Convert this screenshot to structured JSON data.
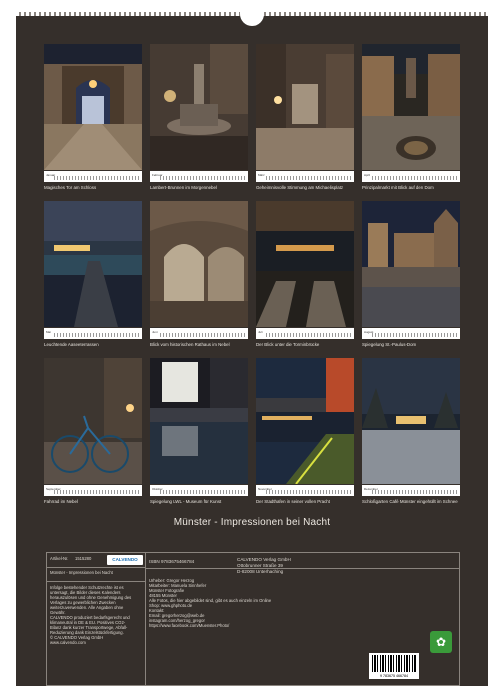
{
  "title": "Münster - Impressionen bei Nacht",
  "months": [
    {
      "month": "Januar",
      "caption": "Magisches Tor am Schloss"
    },
    {
      "month": "Februar",
      "caption": "Lambert-Brunnen im Morgennebel"
    },
    {
      "month": "März",
      "caption": "Geheimnisvolle Stimmung am Michaelisplatz"
    },
    {
      "month": "April",
      "caption": "Prinzipalmarkt mit Blick auf den Dom"
    },
    {
      "month": "Mai",
      "caption": "Leuchtende Aaseeterrassen"
    },
    {
      "month": "Juni",
      "caption": "Blick vom historischen Rathaus im Nebel"
    },
    {
      "month": "Juli",
      "caption": "Der Blick unter die Torminbrücke"
    },
    {
      "month": "August",
      "caption": "Spiegelung St.-Paulus-Dom"
    },
    {
      "month": "September",
      "caption": "Fahrrad im Nebel"
    },
    {
      "month": "Oktober",
      "caption": "Spiegelung LWL - Museum für Kunst"
    },
    {
      "month": "November",
      "caption": "Der Stadthafen in seiner vollen Pracht"
    },
    {
      "month": "Dezember",
      "caption": "Schloßgarten Café Münster eingehüllt im Schnee"
    }
  ],
  "info": {
    "artikel_label": "Artikel-Nr.",
    "artikel_value": "1515280",
    "logo": "CALVENDO",
    "product_name": "Münster - Impressionen bei Nacht",
    "legal": [
      "Infolge bestehender Schutzrechte ist es",
      "untersagt, die Bilder dieses Kalenders",
      "herauszulösen und ohne Genehmigung des",
      "Verlages zu gewerblichen Zwecken",
      "weiterzuverwenden. Alle Angaben ohne",
      "Gewähr.",
      "CALVENDO produziert bedarfsgerecht und",
      "klimaneutral in DE & EU. Positives CO2-",
      "Bilanz dank kurzer Transportwege, Abfall-",
      "Reduzierung dank Einzelstückfertigung.",
      "© CALVENDO Verlag GmbH",
      "www.calvendo.com"
    ],
    "isbn": "ISBN 9783675466784",
    "publisher": [
      "CALVENDO Verlag GmbH",
      "Ottobrunner Straße 39",
      "D-82008 Unterhaching"
    ],
    "author": [
      "Urheber: Gregor Herzog",
      "Mitarbeiter: Manuela Sinnhefer",
      "Münster Fotografie",
      "48155 Münster",
      "Alle Fotos, die hier abgebildet sind, gibt es auch einzeln im Online",
      "Shop: www.ghphoto.de",
      "Kontakt:",
      "Email: gregorherzog@web.de",
      "instagram.com/herzog_gregor",
      "https://www.facebook.com/Muenster.Photo/"
    ],
    "barcode_number": "9 783675 466784"
  }
}
